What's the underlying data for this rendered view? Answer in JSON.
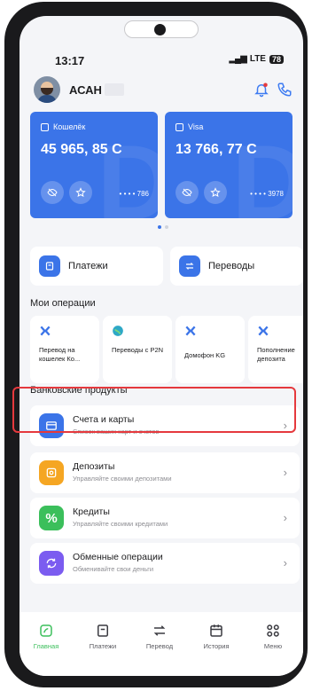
{
  "status_bar": {
    "time": "13:17",
    "network": "LTE",
    "battery": "78"
  },
  "header": {
    "username": "АСАН"
  },
  "accounts": [
    {
      "label": "Кошелёк",
      "amount": "45 965, 85 С",
      "number": "• • • • 786"
    },
    {
      "label": "Visa",
      "amount": "13 766, 77 С",
      "number": "• • • • 3978"
    }
  ],
  "actions": {
    "payments": "Платежи",
    "transfers": "Переводы"
  },
  "operations": {
    "title": "Мои операции",
    "items": [
      {
        "label": "Перевод на кошелек Ко...",
        "icon": "wallet-transfer-icon",
        "color": "#3b74e8"
      },
      {
        "label": "Переводы с P2N",
        "icon": "globe-icon",
        "color": "#2ea8c6"
      },
      {
        "label": "Домофон KG",
        "icon": "intercom-icon",
        "color": "#3b74e8"
      },
      {
        "label": "Пополнение депозита",
        "icon": "deposit-icon",
        "color": "#3b74e8"
      }
    ]
  },
  "products": {
    "title": "Банковские продукты",
    "items": [
      {
        "title": "Счета и карты",
        "subtitle": "Список ваших карт и счетов",
        "icon": "card-icon",
        "color": "#3b74e8"
      },
      {
        "title": "Депозиты",
        "subtitle": "Управляйте своими депозитами",
        "icon": "deposit-icon",
        "color": "#f5a623"
      },
      {
        "title": "Кредиты",
        "subtitle": "Управляйте своими кредитами",
        "icon": "percent-icon",
        "color": "#3bbf5b"
      },
      {
        "title": "Обменные операции",
        "subtitle": "Обменивайте свои деньги",
        "icon": "exchange-icon",
        "color": "#7b5cf0"
      }
    ]
  },
  "tabs": [
    {
      "label": "Главная",
      "icon": "home-icon",
      "active": true
    },
    {
      "label": "Платежи",
      "icon": "payments-icon",
      "active": false
    },
    {
      "label": "Перевод",
      "icon": "transfer-icon",
      "active": false
    },
    {
      "label": "История",
      "icon": "history-icon",
      "active": false
    },
    {
      "label": "Меню",
      "icon": "menu-grid-icon",
      "active": false
    }
  ],
  "colors": {
    "accent": "#3b74e8",
    "active_tab": "#3bbf5b",
    "highlight": "#e5393d"
  }
}
